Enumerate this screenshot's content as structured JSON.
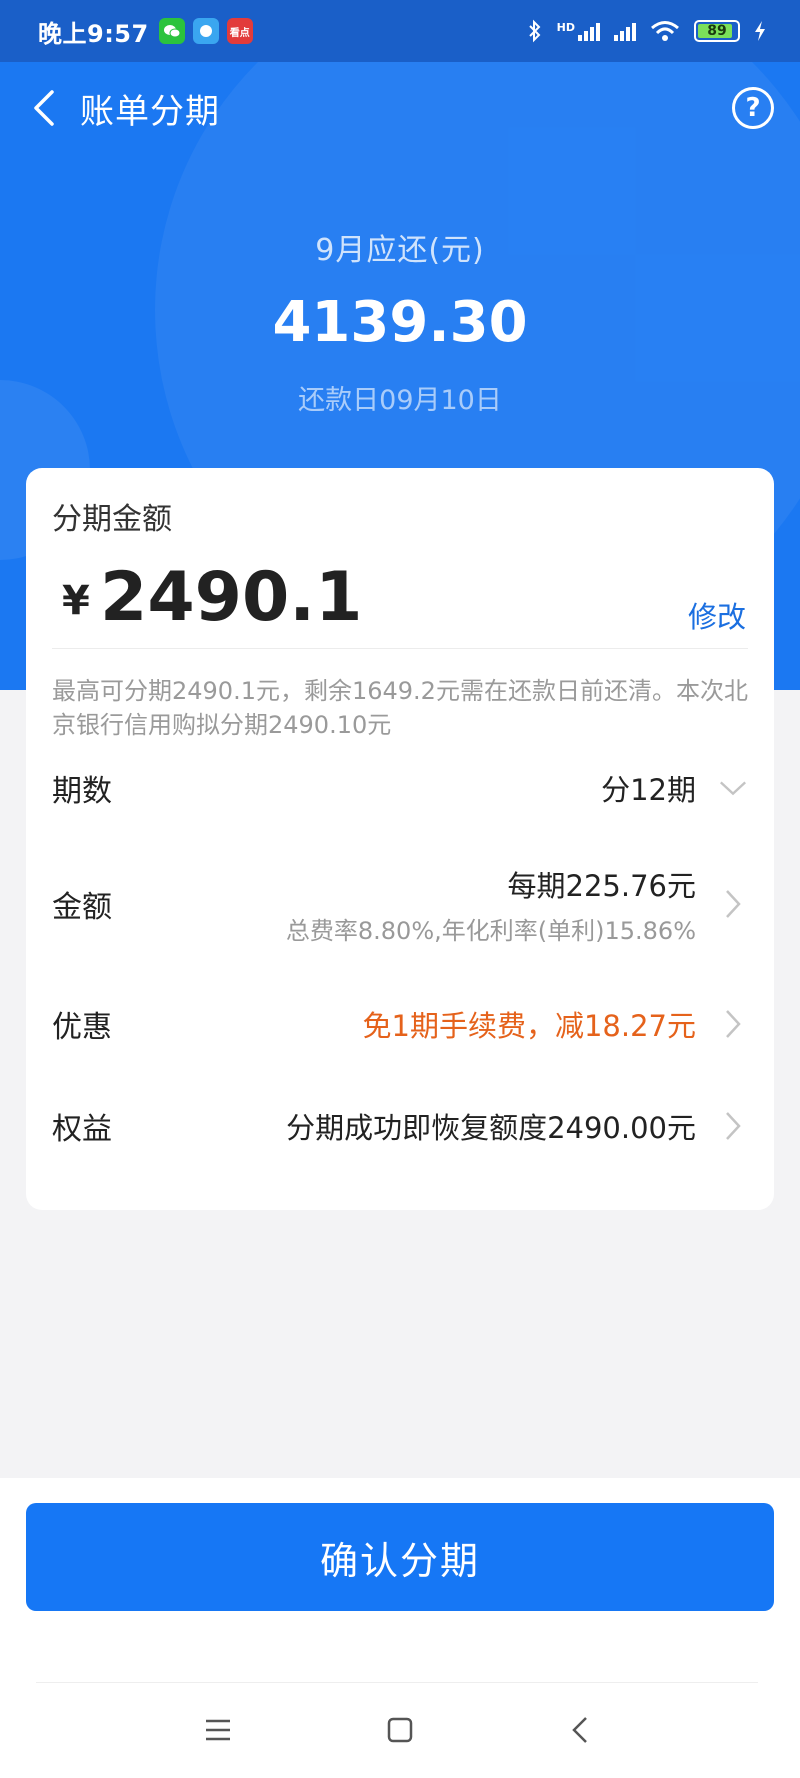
{
  "status_bar": {
    "time": "晚上9:57",
    "battery": "89",
    "network": "HD",
    "app_icons": [
      "wechat-icon",
      "browser-icon",
      "news-app-icon"
    ],
    "kandian_label": "看点"
  },
  "nav": {
    "title": "账单分期",
    "help": "?"
  },
  "summary": {
    "due_label": "9月应还(元)",
    "due_amount": "4139.30",
    "due_date": "还款日09月10日"
  },
  "installment": {
    "title": "分期金额",
    "currency": "¥",
    "amount": "2490.1",
    "modify_label": "修改",
    "note": "最高可分期2490.1元，剩余1649.2元需在还款日前还清。本次北京银行信用购拟分期2490.10元"
  },
  "rows": {
    "periods": {
      "label": "期数",
      "value": "分12期"
    },
    "amount": {
      "label": "金额",
      "value": "每期225.76元",
      "sub": "总费率8.80%,年化利率(单利)15.86%"
    },
    "discount": {
      "label": "优惠",
      "value": "免1期手续费，减18.27元"
    },
    "benefit": {
      "label": "权益",
      "value": "分期成功即恢复额度2490.00元"
    }
  },
  "confirm": {
    "label": "确认分期"
  },
  "colors": {
    "primary": "#1b78f2",
    "button": "#1677f5",
    "accent_orange": "#e5621b"
  }
}
